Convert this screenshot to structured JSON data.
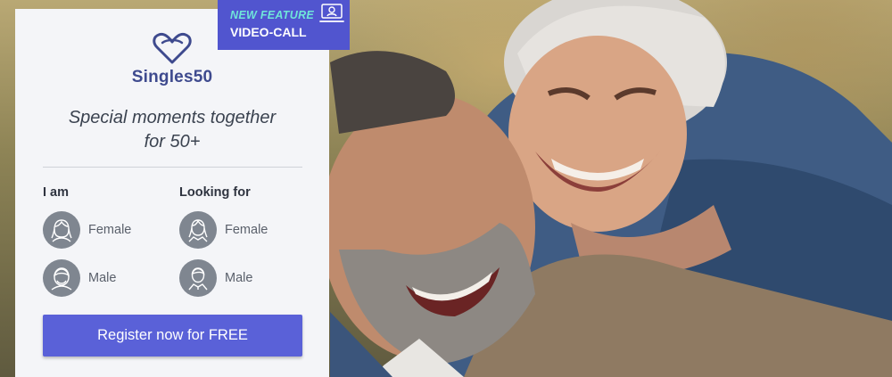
{
  "brand": {
    "name": "Singles50",
    "tagline_line1": "Special moments together",
    "tagline_line2": "for 50+",
    "accent_color": "#3e4a8e"
  },
  "badge": {
    "label_new": "NEW FEATURE",
    "label_feature": "VIDEO-CALL",
    "icon": "video-call-icon"
  },
  "form": {
    "i_am": {
      "heading": "I am",
      "options": [
        "Female",
        "Male"
      ]
    },
    "looking_for": {
      "heading": "Looking for",
      "options": [
        "Female",
        "Male"
      ]
    },
    "register_label": "Register now for FREE",
    "button_color": "#5a61d8"
  },
  "icons": [
    "heart-logo-icon",
    "female-avatar-icon",
    "male-avatar-icon",
    "video-call-icon"
  ]
}
